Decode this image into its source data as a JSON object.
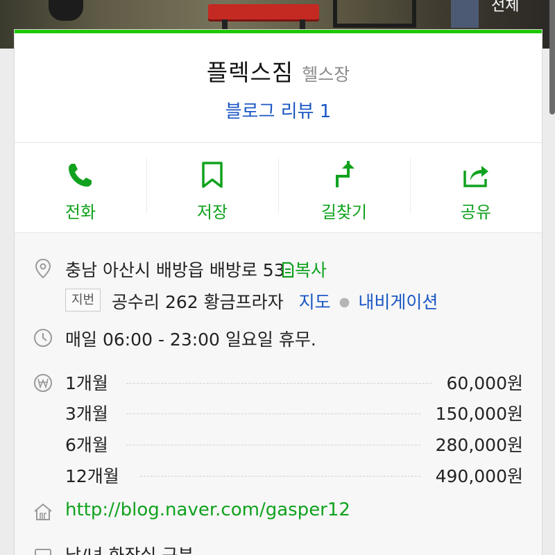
{
  "photo": {
    "all_label": "전체"
  },
  "place": {
    "name": "플렉스짐",
    "category": "헬스장",
    "blog_review": "블로그 리뷰 1"
  },
  "actions": [
    {
      "label": "전화",
      "icon": "phone-icon"
    },
    {
      "label": "저장",
      "icon": "bookmark-icon"
    },
    {
      "label": "길찾기",
      "icon": "directions-icon"
    },
    {
      "label": "공유",
      "icon": "share-icon"
    }
  ],
  "address": {
    "road": "충남 아산시 배방읍 배방로 53",
    "copy_label": "복사",
    "jibun_tag": "지번",
    "jibun": "공수리 262 황금프라자",
    "map_label": "지도",
    "nav_label": "내비게이션"
  },
  "hours": "매일 06:00 - 23:00 일요일 휴무.",
  "prices": [
    {
      "name": "1개월",
      "value": "60,000원"
    },
    {
      "name": "3개월",
      "value": "150,000원"
    },
    {
      "name": "6개월",
      "value": "280,000원"
    },
    {
      "name": "12개월",
      "value": "490,000원"
    }
  ],
  "homepage": "http://blog.naver.com/gasper12",
  "truncated_text": "남/녀 화장실 구분",
  "colors": {
    "accent_green": "#1ec800",
    "label_green": "#10a21e",
    "link_blue": "#1a57c4"
  }
}
